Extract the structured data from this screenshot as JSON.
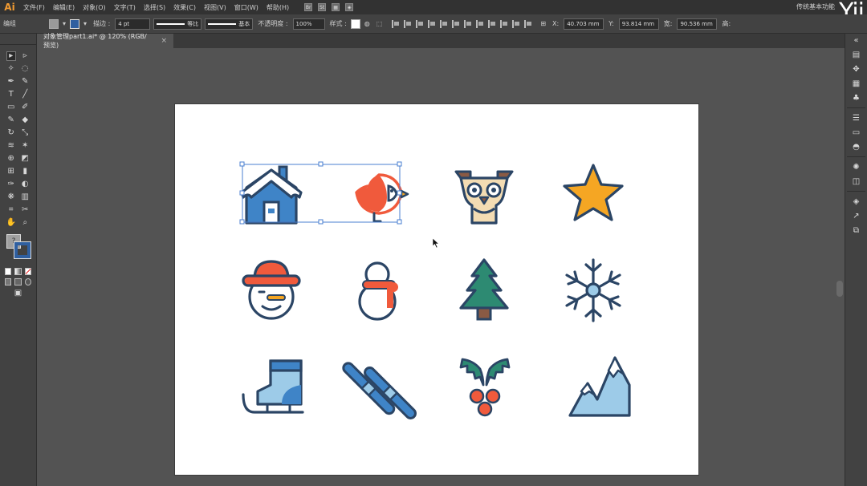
{
  "app": {
    "logo": "Ai",
    "workspace": "传统基本功能",
    "watermark": "Yii"
  },
  "menu": [
    "文件(F)",
    "编辑(E)",
    "对象(O)",
    "文字(T)",
    "选择(S)",
    "效果(C)",
    "视图(V)",
    "窗口(W)",
    "帮助(H)"
  ],
  "menu_icons": [
    "Br",
    "St"
  ],
  "control": {
    "mode": "编组",
    "stroke_label": "描边 :",
    "stroke_weight": "4 pt",
    "profile_label": "等比",
    "brush_label": "基本",
    "opacity_label": "不透明度 :",
    "opacity_value": "100%",
    "style_label": "样式 :",
    "x_label": "X:",
    "x_value": "40.703 mm",
    "y_label": "Y:",
    "y_value": "93.814 mm",
    "w_label": "宽:",
    "w_value": "90.536 mm",
    "h_label": "高:"
  },
  "document": {
    "tab_title": "对象管理part1.ai* @ 120% (RGB/预览)",
    "close": "×"
  },
  "colors": {
    "navy": "#2b4565",
    "blue": "#3f84c7",
    "light_blue": "#9dcbe8",
    "orange_red": "#f05a3c",
    "amber": "#f5a623",
    "green": "#2d8a72",
    "brown": "#8a5a44",
    "tan": "#f3dcb3",
    "selection": "#4a7fd0"
  },
  "icons": [
    "house-snow-icon",
    "bird-icon",
    "reindeer-owl-icon",
    "star-icon",
    "snowman-face-icon",
    "snowman-icon",
    "pine-tree-icon",
    "snowflake-icon",
    "ice-skate-icon",
    "skis-icon",
    "holly-icon",
    "mountain-icon"
  ]
}
